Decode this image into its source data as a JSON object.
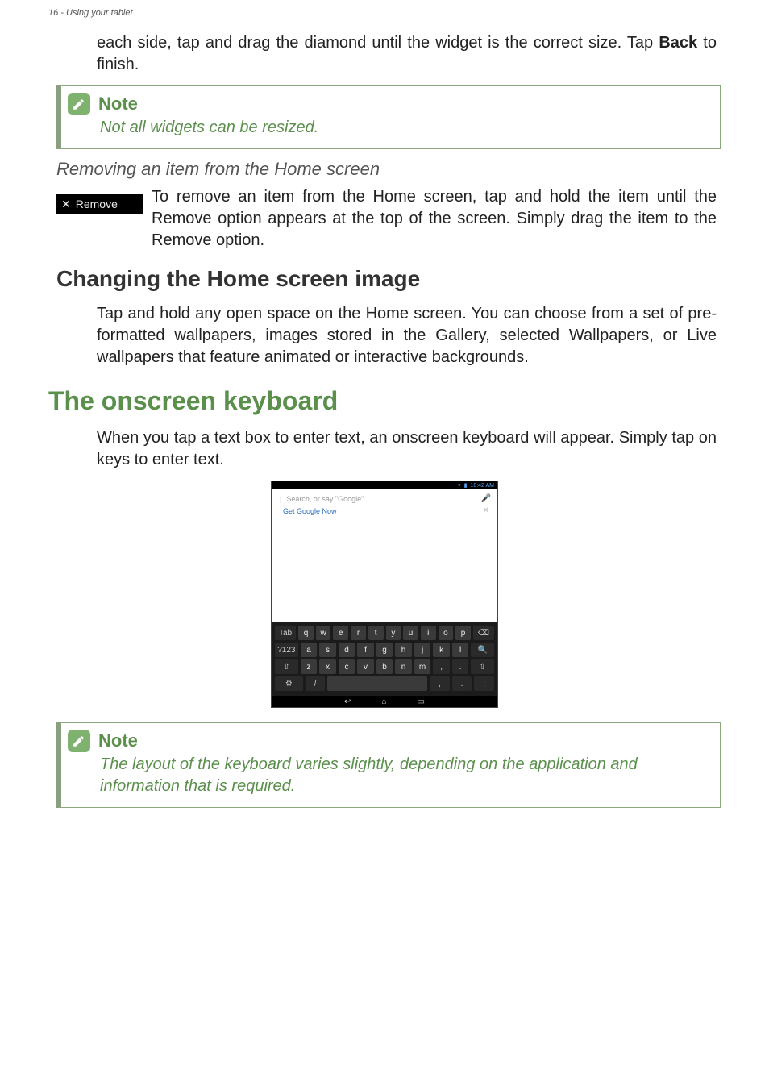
{
  "header": {
    "text": "16 - Using your tablet"
  },
  "paragraphs": {
    "resize_widget": {
      "pre": "each side, tap and drag the diamond until the widget is the correct size. Tap ",
      "bold": "Back",
      "post": " to finish."
    },
    "change_image": "Tap and hold any open space on the Home screen. You can choose from a set of pre-formatted wallpapers, images stored in the Gallery, selected Wallpapers, or Live wallpapers that feature animated or interactive backgrounds.",
    "onscreen_intro": "When you tap a text box to enter text, an onscreen keyboard will appear. Simply tap on keys to enter text."
  },
  "notes": {
    "title": "Note",
    "note1": "Not all widgets can be resized.",
    "note2": "The layout of the keyboard varies slightly, depending on the application and information that is required."
  },
  "sections": {
    "removing_item_h3": "Removing an item from the Home screen",
    "changing_image_h2": "Changing the Home screen image",
    "onscreen_h1": "The onscreen keyboard"
  },
  "remove": {
    "badge_label": "Remove",
    "para_pre": "To remove an item from the Home screen, tap and hold the item until the ",
    "bold1": "Remove",
    "mid": " option appears at the top of the screen. Simply drag the item to the ",
    "bold2": "Remove",
    "post": " option."
  },
  "screenshot": {
    "status_time": "10:42 AM",
    "search_placeholder": "Search, or say \"Google\"",
    "suggest_label": "Get Google Now",
    "keys": {
      "row1_pre": "Tab",
      "row1": [
        "q",
        "w",
        "e",
        "r",
        "t",
        "y",
        "u",
        "i",
        "o",
        "p"
      ],
      "row1_post": "⌫",
      "row2_pre": "?123",
      "row2": [
        "a",
        "s",
        "d",
        "f",
        "g",
        "h",
        "j",
        "k",
        "l"
      ],
      "row2_post": "🔍",
      "row3_pre": "⇧",
      "row3": [
        "z",
        "x",
        "c",
        "v",
        "b",
        "n",
        "m",
        ",",
        "."
      ],
      "row3_post": "⇧",
      "row4_pre": "⚙",
      "row4_slash": "/",
      "row4_comma": ",",
      "row4_period": ".",
      "row4_colon": ":"
    },
    "nav": {
      "back": "↩",
      "home": "⌂",
      "recent": "▭"
    }
  }
}
